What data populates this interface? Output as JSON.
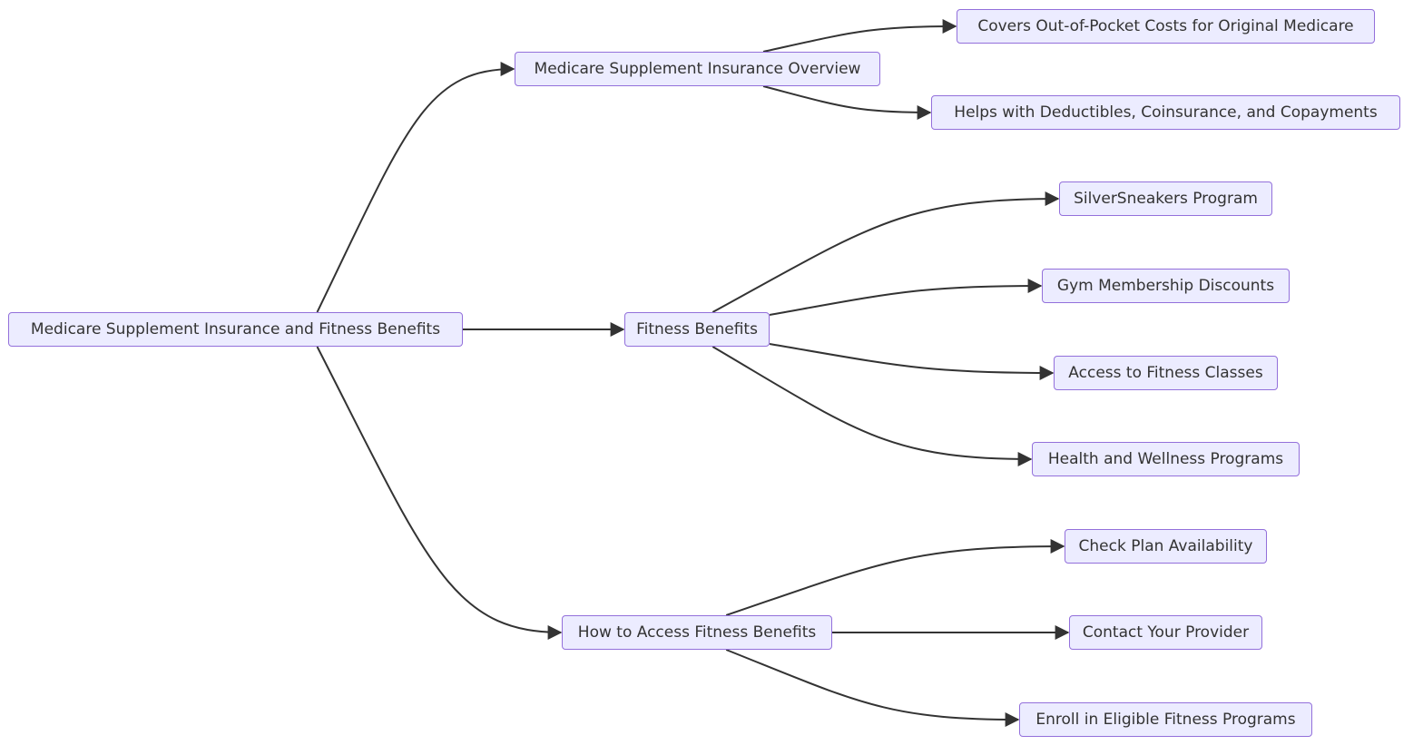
{
  "diagram": {
    "type": "flowchart-LR",
    "colors": {
      "node_fill": "#ECECFF",
      "node_stroke": "#9370DB",
      "text": "#333333",
      "edge": "#333333"
    },
    "nodes": {
      "root": {
        "label": "Medicare Supplement Insurance and Fitness Benefits"
      },
      "overview": {
        "label": "Medicare Supplement Insurance Overview"
      },
      "fitness": {
        "label": "Fitness Benefits"
      },
      "howto": {
        "label": "How to Access Fitness Benefits"
      },
      "covers": {
        "label": "Covers Out-of-Pocket Costs for Original Medicare"
      },
      "helps": {
        "label": "Helps with Deductibles, Coinsurance, and Copayments"
      },
      "silver": {
        "label": "SilverSneakers Program"
      },
      "gym": {
        "label": "Gym Membership Discounts"
      },
      "classes": {
        "label": "Access to Fitness Classes"
      },
      "wellness": {
        "label": "Health and Wellness Programs"
      },
      "check": {
        "label": "Check Plan Availability"
      },
      "contact": {
        "label": "Contact Your Provider"
      },
      "enroll": {
        "label": "Enroll in Eligible Fitness Programs"
      }
    },
    "edges": [
      {
        "from": "root",
        "to": "overview"
      },
      {
        "from": "root",
        "to": "fitness"
      },
      {
        "from": "root",
        "to": "howto"
      },
      {
        "from": "overview",
        "to": "covers"
      },
      {
        "from": "overview",
        "to": "helps"
      },
      {
        "from": "fitness",
        "to": "silver"
      },
      {
        "from": "fitness",
        "to": "gym"
      },
      {
        "from": "fitness",
        "to": "classes"
      },
      {
        "from": "fitness",
        "to": "wellness"
      },
      {
        "from": "howto",
        "to": "check"
      },
      {
        "from": "howto",
        "to": "contact"
      },
      {
        "from": "howto",
        "to": "enroll"
      }
    ]
  }
}
